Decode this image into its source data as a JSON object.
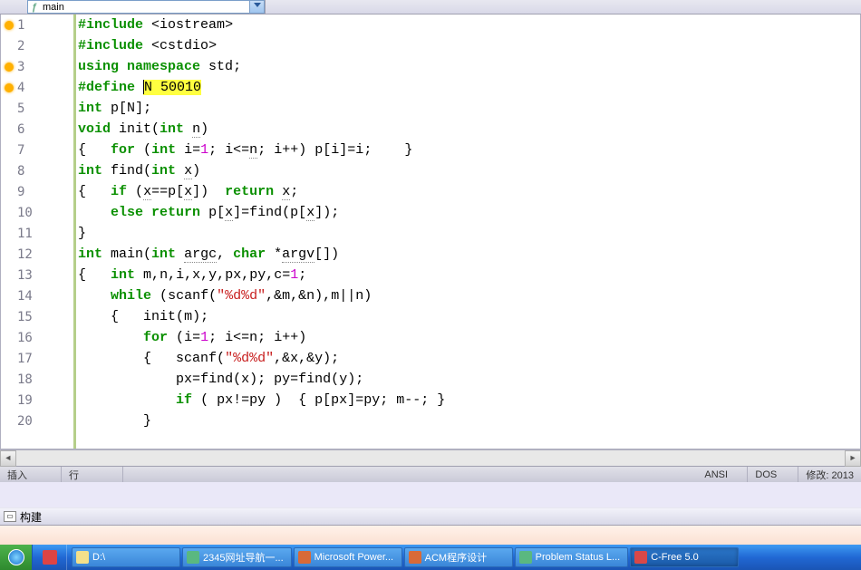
{
  "combo": {
    "label": "main"
  },
  "code": {
    "lines": [
      {
        "n": 1,
        "marker": true,
        "tokens": [
          [
            "pp",
            "#include"
          ],
          [
            "id",
            " "
          ],
          [
            "op",
            "<"
          ],
          [
            "id",
            "iostream"
          ],
          [
            "op",
            ">"
          ]
        ]
      },
      {
        "n": 2,
        "marker": false,
        "tokens": [
          [
            "pp",
            "#include"
          ],
          [
            "id",
            " "
          ],
          [
            "op",
            "<"
          ],
          [
            "id",
            "cstdio"
          ],
          [
            "op",
            ">"
          ]
        ]
      },
      {
        "n": 3,
        "marker": true,
        "tokens": [
          [
            "kw",
            "using"
          ],
          [
            "id",
            " "
          ],
          [
            "kw",
            "namespace"
          ],
          [
            "id",
            " std"
          ],
          [
            "op",
            ";"
          ]
        ]
      },
      {
        "n": 4,
        "marker": true,
        "tokens": [
          [
            "pp",
            "#define"
          ],
          [
            "id",
            " "
          ],
          [
            "hl",
            "N 50010"
          ]
        ],
        "cursor": true
      },
      {
        "n": 5,
        "marker": false,
        "tokens": [
          [
            "ty",
            "int"
          ],
          [
            "id",
            " p"
          ],
          [
            "op",
            "["
          ],
          [
            "id",
            "N"
          ],
          [
            "op",
            "];"
          ]
        ]
      },
      {
        "n": 6,
        "marker": false,
        "tokens": [
          [
            "ty",
            "void"
          ],
          [
            "id",
            " init"
          ],
          [
            "op",
            "("
          ],
          [
            "ty",
            "int"
          ],
          [
            "id",
            " "
          ],
          [
            "und",
            "n"
          ],
          [
            "op",
            ")"
          ]
        ]
      },
      {
        "n": 7,
        "marker": false,
        "tokens": [
          [
            "op",
            "{   "
          ],
          [
            "kw",
            "for"
          ],
          [
            "id",
            " "
          ],
          [
            "op",
            "("
          ],
          [
            "ty",
            "int"
          ],
          [
            "id",
            " i"
          ],
          [
            "op",
            "="
          ],
          [
            "num",
            "1"
          ],
          [
            "op",
            "; "
          ],
          [
            "id",
            "i"
          ],
          [
            "op",
            "<="
          ],
          [
            "und",
            "n"
          ],
          [
            "op",
            "; "
          ],
          [
            "id",
            "i"
          ],
          [
            "op",
            "++) "
          ],
          [
            "id",
            "p"
          ],
          [
            "op",
            "["
          ],
          [
            "id",
            "i"
          ],
          [
            "op",
            "]="
          ],
          [
            "id",
            "i"
          ],
          [
            "op",
            ";    }"
          ]
        ]
      },
      {
        "n": 8,
        "marker": false,
        "tokens": [
          [
            "ty",
            "int"
          ],
          [
            "id",
            " find"
          ],
          [
            "op",
            "("
          ],
          [
            "ty",
            "int"
          ],
          [
            "id",
            " "
          ],
          [
            "und",
            "x"
          ],
          [
            "op",
            ")"
          ]
        ]
      },
      {
        "n": 9,
        "marker": false,
        "tokens": [
          [
            "op",
            "{   "
          ],
          [
            "kw",
            "if"
          ],
          [
            "id",
            " "
          ],
          [
            "op",
            "("
          ],
          [
            "und",
            "x"
          ],
          [
            "op",
            "=="
          ],
          [
            "id",
            "p"
          ],
          [
            "op",
            "["
          ],
          [
            "und",
            "x"
          ],
          [
            "op",
            "])  "
          ],
          [
            "kw",
            "return"
          ],
          [
            "id",
            " "
          ],
          [
            "und",
            "x"
          ],
          [
            "op",
            ";"
          ]
        ]
      },
      {
        "n": 10,
        "marker": false,
        "tokens": [
          [
            "id",
            "    "
          ],
          [
            "kw",
            "else"
          ],
          [
            "id",
            " "
          ],
          [
            "kw",
            "return"
          ],
          [
            "id",
            " p"
          ],
          [
            "op",
            "["
          ],
          [
            "und",
            "x"
          ],
          [
            "op",
            "]="
          ],
          [
            "id",
            "find"
          ],
          [
            "op",
            "("
          ],
          [
            "id",
            "p"
          ],
          [
            "op",
            "["
          ],
          [
            "und",
            "x"
          ],
          [
            "op",
            "]);"
          ]
        ]
      },
      {
        "n": 11,
        "marker": false,
        "tokens": [
          [
            "op",
            "}"
          ]
        ]
      },
      {
        "n": 12,
        "marker": false,
        "tokens": [
          [
            "ty",
            "int"
          ],
          [
            "id",
            " main"
          ],
          [
            "op",
            "("
          ],
          [
            "ty",
            "int"
          ],
          [
            "id",
            " "
          ],
          [
            "und",
            "argc"
          ],
          [
            "op",
            ", "
          ],
          [
            "ty",
            "char"
          ],
          [
            "id",
            " "
          ],
          [
            "op",
            "*"
          ],
          [
            "und",
            "argv"
          ],
          [
            "op",
            "[])"
          ]
        ]
      },
      {
        "n": 13,
        "marker": false,
        "tokens": [
          [
            "op",
            "{   "
          ],
          [
            "ty",
            "int"
          ],
          [
            "id",
            " m"
          ],
          [
            "op",
            ","
          ],
          [
            "id",
            "n"
          ],
          [
            "op",
            ","
          ],
          [
            "id",
            "i"
          ],
          [
            "op",
            ","
          ],
          [
            "id",
            "x"
          ],
          [
            "op",
            ","
          ],
          [
            "id",
            "y"
          ],
          [
            "op",
            ","
          ],
          [
            "id",
            "px"
          ],
          [
            "op",
            ","
          ],
          [
            "id",
            "py"
          ],
          [
            "op",
            ","
          ],
          [
            "id",
            "c"
          ],
          [
            "op",
            "="
          ],
          [
            "num",
            "1"
          ],
          [
            "op",
            ";"
          ]
        ]
      },
      {
        "n": 14,
        "marker": false,
        "tokens": [
          [
            "id",
            "    "
          ],
          [
            "kw",
            "while"
          ],
          [
            "id",
            " "
          ],
          [
            "op",
            "("
          ],
          [
            "id",
            "scanf"
          ],
          [
            "op",
            "("
          ],
          [
            "str",
            "\"%d%d\""
          ],
          [
            "op",
            ",&"
          ],
          [
            "id",
            "m"
          ],
          [
            "op",
            ",&"
          ],
          [
            "id",
            "n"
          ],
          [
            "op",
            "),"
          ],
          [
            "id",
            "m"
          ],
          [
            "op",
            "||"
          ],
          [
            "id",
            "n"
          ],
          [
            "op",
            ")"
          ]
        ]
      },
      {
        "n": 15,
        "marker": false,
        "tokens": [
          [
            "id",
            "    "
          ],
          [
            "op",
            "{   "
          ],
          [
            "id",
            "init"
          ],
          [
            "op",
            "("
          ],
          [
            "id",
            "m"
          ],
          [
            "op",
            ");"
          ]
        ]
      },
      {
        "n": 16,
        "marker": false,
        "tokens": [
          [
            "id",
            "        "
          ],
          [
            "kw",
            "for"
          ],
          [
            "id",
            " "
          ],
          [
            "op",
            "("
          ],
          [
            "id",
            "i"
          ],
          [
            "op",
            "="
          ],
          [
            "num",
            "1"
          ],
          [
            "op",
            "; "
          ],
          [
            "id",
            "i"
          ],
          [
            "op",
            "<="
          ],
          [
            "id",
            "n"
          ],
          [
            "op",
            "; "
          ],
          [
            "id",
            "i"
          ],
          [
            "op",
            "++)"
          ]
        ]
      },
      {
        "n": 17,
        "marker": false,
        "tokens": [
          [
            "id",
            "        "
          ],
          [
            "op",
            "{   "
          ],
          [
            "id",
            "scanf"
          ],
          [
            "op",
            "("
          ],
          [
            "str",
            "\"%d%d\""
          ],
          [
            "op",
            ",&"
          ],
          [
            "id",
            "x"
          ],
          [
            "op",
            ",&"
          ],
          [
            "id",
            "y"
          ],
          [
            "op",
            ");"
          ]
        ]
      },
      {
        "n": 18,
        "marker": false,
        "tokens": [
          [
            "id",
            "            "
          ],
          [
            "id",
            "px"
          ],
          [
            "op",
            "="
          ],
          [
            "id",
            "find"
          ],
          [
            "op",
            "("
          ],
          [
            "id",
            "x"
          ],
          [
            "op",
            "); "
          ],
          [
            "id",
            "py"
          ],
          [
            "op",
            "="
          ],
          [
            "id",
            "find"
          ],
          [
            "op",
            "("
          ],
          [
            "id",
            "y"
          ],
          [
            "op",
            ");"
          ]
        ]
      },
      {
        "n": 19,
        "marker": false,
        "tokens": [
          [
            "id",
            "            "
          ],
          [
            "kw",
            "if"
          ],
          [
            "id",
            " "
          ],
          [
            "op",
            "( "
          ],
          [
            "id",
            "px"
          ],
          [
            "op",
            "!="
          ],
          [
            "id",
            "py"
          ],
          [
            "op",
            " )  { "
          ],
          [
            "id",
            "p"
          ],
          [
            "op",
            "["
          ],
          [
            "id",
            "px"
          ],
          [
            "op",
            "]="
          ],
          [
            "id",
            "py"
          ],
          [
            "op",
            "; "
          ],
          [
            "id",
            "m"
          ],
          [
            "op",
            "--; }"
          ]
        ]
      },
      {
        "n": 20,
        "marker": false,
        "tokens": [
          [
            "id",
            "        "
          ],
          [
            "op",
            "}"
          ]
        ]
      }
    ]
  },
  "status": {
    "insert": "插入",
    "line": "行",
    "ansi": "ANSI",
    "dos": "DOS",
    "modify": "修改: 2013"
  },
  "build": {
    "title": "构建"
  },
  "taskbar": {
    "items": [
      {
        "label": "D:\\",
        "icon": "#f4e08a"
      },
      {
        "label": "2345网址导航一...",
        "icon": "#5ab880"
      },
      {
        "label": "Microsoft Power...",
        "icon": "#d86a38"
      },
      {
        "label": "ACM程序设计",
        "icon": "#d86a38"
      },
      {
        "label": "Problem Status L...",
        "icon": "#5ab880"
      },
      {
        "label": "C-Free 5.0",
        "icon": "#d84848",
        "active": true
      }
    ]
  }
}
